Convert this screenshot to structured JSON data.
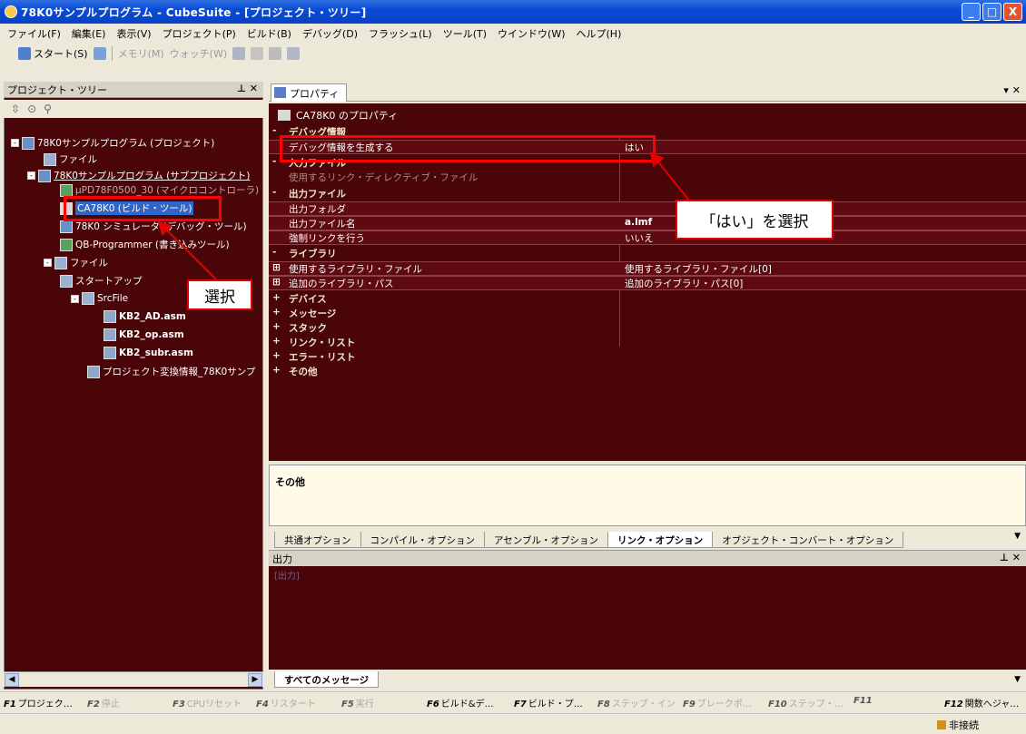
{
  "window": {
    "title": "78K0サンプルプログラム - CubeSuite - [プロジェクト・ツリー]",
    "min": "_",
    "max": "□",
    "close": "X"
  },
  "menu": [
    "ファイル(F)",
    "編集(E)",
    "表示(V)",
    "プロジェクト(P)",
    "ビルド(B)",
    "デバッグ(D)",
    "フラッシュ(L)",
    "ツール(T)",
    "ウインドウ(W)",
    "ヘルプ(H)"
  ],
  "toolbar": {
    "start": "スタート(S)",
    "disabled1": "メモリ(M)",
    "disabled2": "ウォッチ(W)"
  },
  "left_pane": {
    "title": "プロジェクト・ツリー",
    "controls": "⊥ ✕",
    "tools": [
      "⇳",
      "⊙",
      "⚲"
    ],
    "tree": [
      {
        "label": "78K0サンプルプログラム (プロジェクト)",
        "exp": "-"
      },
      {
        "label": "ファイル",
        "exp": ""
      },
      {
        "label": "78K0サンプルプログラム (サブプロジェクト)",
        "exp": "-"
      },
      {
        "label": "μPD78F0500_30 (マイクロコントローラ)",
        "exp": ""
      },
      {
        "label": "CA78K0 (ビルド・ツール)",
        "exp": ""
      },
      {
        "label": "78K0 シミュレータ (デバッグ・ツール)",
        "exp": ""
      },
      {
        "label": "QB-Programmer (書き込みツール)",
        "exp": ""
      },
      {
        "label": "ファイル",
        "exp": "-"
      },
      {
        "label": "スタートアップ",
        "exp": ""
      },
      {
        "label": "SrcFile",
        "exp": "-"
      },
      {
        "label": "KB2_AD.asm",
        "exp": ""
      },
      {
        "label": "KB2_op.asm",
        "exp": ""
      },
      {
        "label": "KB2_subr.asm",
        "exp": ""
      },
      {
        "label": "プロジェクト変換情報_78K0サンプ",
        "exp": ""
      }
    ]
  },
  "properties": {
    "tab": "プロパティ",
    "controls": "▾ ✕",
    "header": "CA78K0 のプロパティ",
    "rows": [
      {
        "sign": "-",
        "name": "デバッグ情報",
        "value": ""
      },
      {
        "sign": "",
        "name": "デバッグ情報を生成する",
        "value": "はい"
      },
      {
        "sign": "-",
        "name": "入力ファイル",
        "value": ""
      },
      {
        "sign": "",
        "name": "使用するリンク・ディレクティブ・ファイル",
        "value": ""
      },
      {
        "sign": "-",
        "name": "出力ファイル",
        "value": ""
      },
      {
        "sign": "",
        "name": "出力フォルダ",
        "value": ""
      },
      {
        "sign": "",
        "name": "出力ファイル名",
        "value": "a.lmf"
      },
      {
        "sign": "",
        "name": "強制リンクを行う",
        "value": "いいえ"
      },
      {
        "sign": "-",
        "name": "ライブラリ",
        "value": ""
      },
      {
        "sign": "⊞",
        "name": "使用するライブラリ・ファイル",
        "value": "使用するライブラリ・ファイル[0]"
      },
      {
        "sign": "⊞",
        "name": "追加のライブラリ・パス",
        "value": "追加のライブラリ・パス[0]"
      },
      {
        "sign": "+",
        "name": "デバイス",
        "value": ""
      },
      {
        "sign": "+",
        "name": "メッセージ",
        "value": ""
      },
      {
        "sign": "+",
        "name": "スタック",
        "value": ""
      },
      {
        "sign": "+",
        "name": "リンク・リスト",
        "value": ""
      },
      {
        "sign": "+",
        "name": "エラー・リスト",
        "value": ""
      },
      {
        "sign": "+",
        "name": "その他",
        "value": ""
      }
    ],
    "description": "その他",
    "tabs": [
      "共通オプション",
      "コンパイル・オプション",
      "アセンブル・オプション",
      "リンク・オプション",
      "オブジェクト・コンバート・オプション"
    ]
  },
  "output": {
    "title": "出力",
    "controls": "⊥ ✕",
    "line": "[出力]",
    "tab": "すべてのメッセージ"
  },
  "fkeys": [
    {
      "key": "F1",
      "label": "プロジェク…",
      "enabled": true
    },
    {
      "key": "F2",
      "label": "停止",
      "enabled": false
    },
    {
      "key": "F3",
      "label": "CPUリセット",
      "enabled": false
    },
    {
      "key": "F4",
      "label": "リスタート",
      "enabled": false
    },
    {
      "key": "F5",
      "label": "実行",
      "enabled": false
    },
    {
      "key": "F6",
      "label": "ビルド&デ…",
      "enabled": true
    },
    {
      "key": "F7",
      "label": "ビルド・プ…",
      "enabled": true
    },
    {
      "key": "F8",
      "label": "ステップ・イン",
      "enabled": false
    },
    {
      "key": "F9",
      "label": "ブレークポ…",
      "enabled": false
    },
    {
      "key": "F10",
      "label": "ステップ・…",
      "enabled": false
    },
    {
      "key": "F11",
      "label": "",
      "enabled": false
    },
    {
      "key": "F12",
      "label": "関数へジャ…",
      "enabled": true
    }
  ],
  "status": "非接続",
  "annotations": {
    "select": "選択",
    "choose_yes": "「はい」を選択"
  },
  "colors": {
    "panel_bg": "#4a0508",
    "accent": "#ff0000",
    "selection": "#3165c8"
  }
}
